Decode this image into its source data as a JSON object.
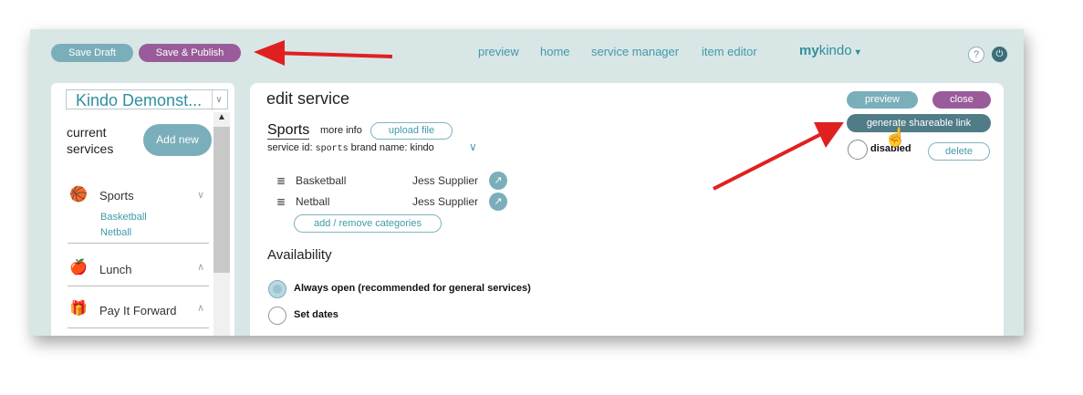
{
  "toolbar": {
    "save_draft": "Save Draft",
    "save_publish": "Save & Publish"
  },
  "nav": {
    "preview": "preview",
    "home": "home",
    "service_manager": "service manager",
    "item_editor": "item editor"
  },
  "brand": {
    "bold": "my",
    "rest": "kindo",
    "caret": "▾"
  },
  "sidebar": {
    "org_select": "Kindo Demonst...",
    "current_services_line1": "current",
    "current_services_line2": "services",
    "add_new": "Add new",
    "categories": [
      {
        "label": "Sports",
        "icon": "sports-ball-icon",
        "sub": [
          "Basketball",
          "Netball"
        ]
      },
      {
        "label": "Lunch",
        "icon": "apple-icon"
      },
      {
        "label": "Pay It Forward",
        "icon": "gift-icon"
      }
    ]
  },
  "main": {
    "title": "edit service",
    "service_name": "Sports",
    "more_info": "more info",
    "upload_file": "upload file",
    "service_id_label": "service id:",
    "service_id": "sports",
    "brand_name_label": "brand name:",
    "brand_name": "kindo",
    "items": [
      {
        "name": "Basketball",
        "supplier": "Jess Supplier"
      },
      {
        "name": "Netball",
        "supplier": "Jess Supplier"
      }
    ],
    "add_remove": "add / remove categories",
    "availability": "Availability",
    "options": [
      {
        "label": "Always open (recommended for general services)",
        "selected": true
      },
      {
        "label": "Set dates",
        "selected": false
      }
    ],
    "preview": "preview",
    "close": "close",
    "generate_link": "generate shareable link",
    "disabled": "disabled",
    "delete": "delete"
  },
  "colors": {
    "teal": "#7aaeba",
    "purple": "#9a5b9a",
    "dark_teal": "#4f7c86",
    "arrow": "#e02020"
  }
}
